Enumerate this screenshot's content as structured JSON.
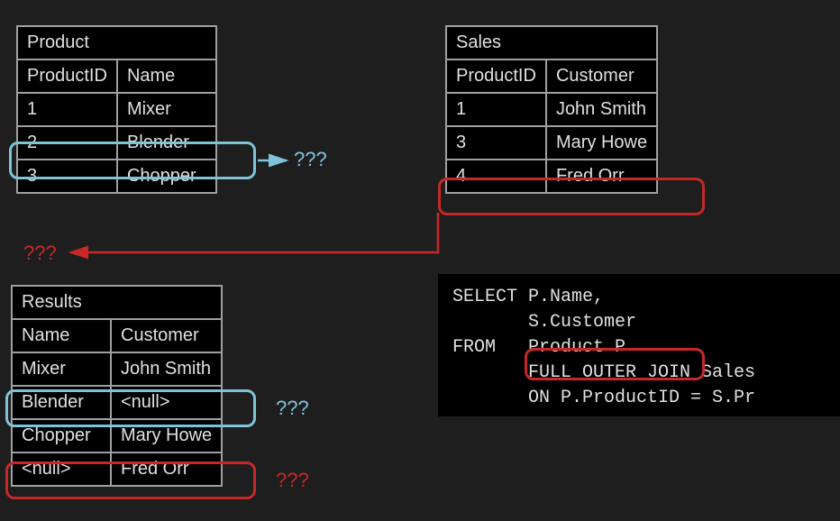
{
  "tables": {
    "product": {
      "title": "Product",
      "headers": [
        "ProductID",
        "Name"
      ],
      "rows": [
        [
          "1",
          "Mixer"
        ],
        [
          "2",
          "Blender"
        ],
        [
          "3",
          "Chopper"
        ]
      ]
    },
    "sales": {
      "title": "Sales",
      "headers": [
        "ProductID",
        "Customer"
      ],
      "rows": [
        [
          "1",
          "John Smith"
        ],
        [
          "3",
          "Mary Howe"
        ],
        [
          "4",
          "Fred Orr"
        ]
      ]
    },
    "results": {
      "title": "Results",
      "headers": [
        "Name",
        "Customer"
      ],
      "rows": [
        [
          "Mixer",
          "John Smith"
        ],
        [
          "Blender",
          "<null>"
        ],
        [
          "Chopper",
          "Mary Howe"
        ],
        [
          "<null>",
          "Fred Orr"
        ]
      ]
    }
  },
  "sql": {
    "line1": "SELECT P.Name,",
    "line2": "       S.Customer",
    "line3": "FROM   Product P",
    "line4a": "       ",
    "line4b": "FULL OUTER JOIN",
    "line4c": " Sales",
    "line5": "       ON P.ProductID = S.Pr"
  },
  "annotations": {
    "q_blue_1": "???",
    "q_red_1": "???",
    "q_blue_2": "???",
    "q_red_2": "???"
  }
}
